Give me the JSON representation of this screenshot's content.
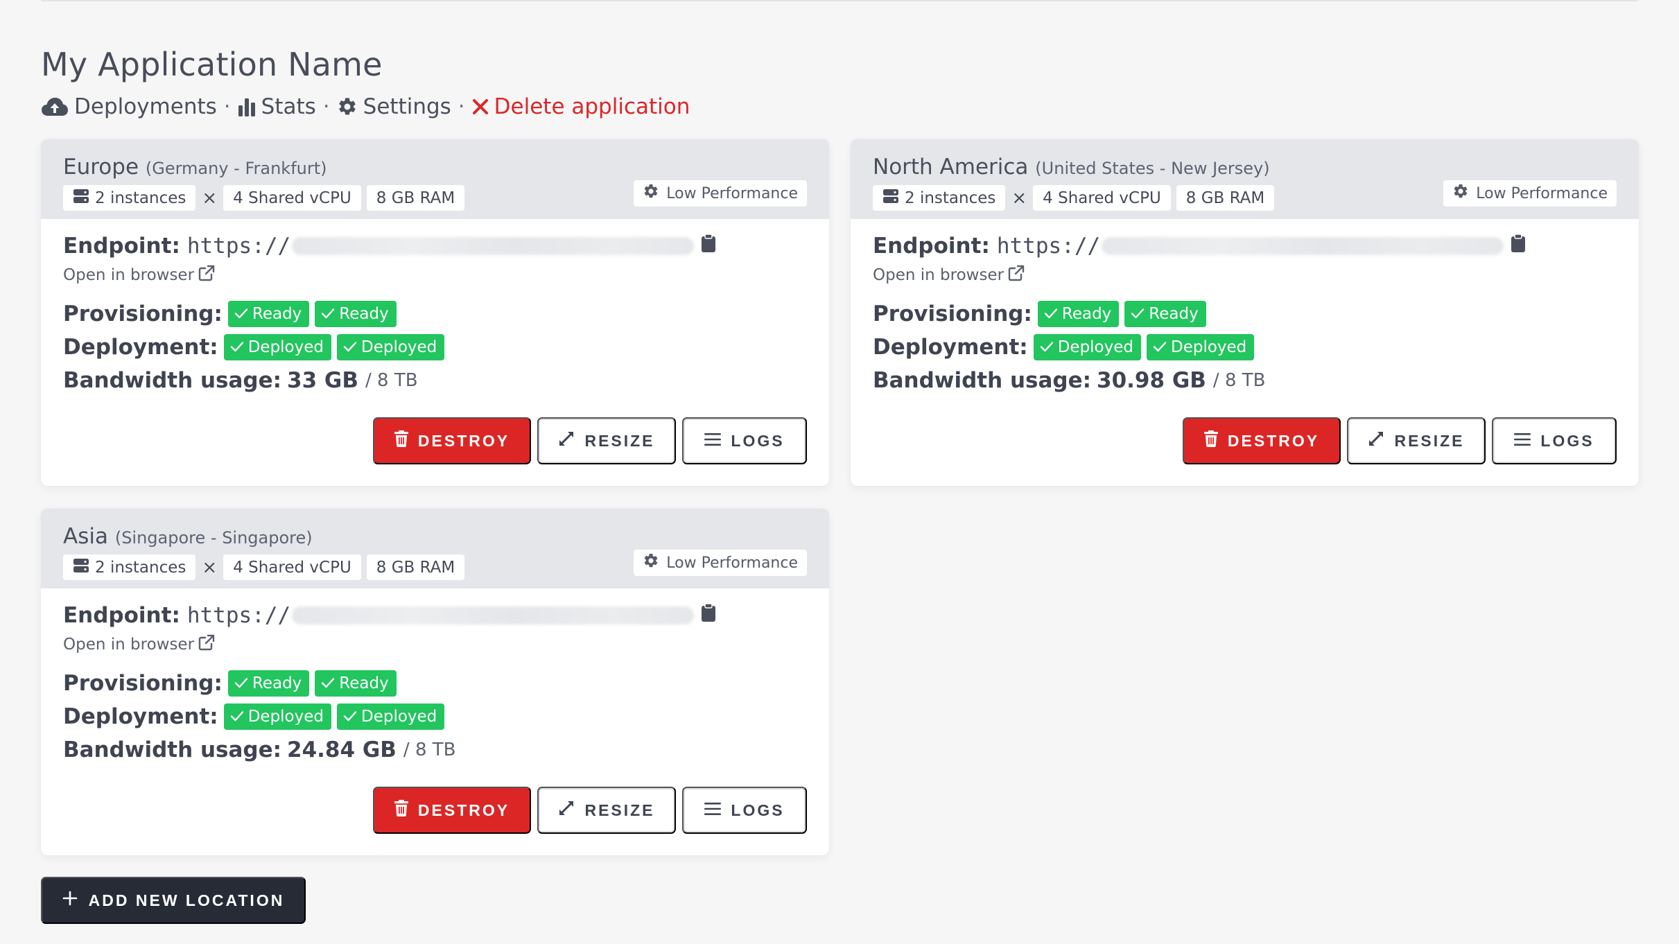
{
  "app": {
    "title": "My Application Name",
    "nav": {
      "deployments": "Deployments",
      "stats": "Stats",
      "settings": "Settings",
      "delete": "Delete application",
      "separator": "·"
    }
  },
  "colors": {
    "danger": "#dc2626",
    "success": "#22c55e",
    "dark_button": "#262b36",
    "card_header": "#e5e6ea"
  },
  "icons": {
    "deployments": "cloud-upload-icon",
    "stats": "bar-chart-icon",
    "settings": "gear-icon",
    "delete": "close-icon",
    "instances": "server-icon",
    "performance": "gear-icon",
    "copy": "clipboard-icon",
    "external": "external-link-icon",
    "status": "check-icon",
    "destroy": "trash-icon",
    "resize": "expand-icon",
    "logs": "menu-lines-icon",
    "add": "plus-icon"
  },
  "locations": [
    {
      "region": "Europe",
      "place": "(Germany - Frankfurt)",
      "instances": "2 instances",
      "times": "×",
      "cpu": "4 Shared vCPU",
      "ram": "8 GB RAM",
      "performance": "Low Performance",
      "endpoint_label": "Endpoint:",
      "endpoint_proto": "https://",
      "open_label": "Open in browser",
      "provisioning_label": "Provisioning:",
      "provisioning": [
        "Ready",
        "Ready"
      ],
      "deployment_label": "Deployment:",
      "deployment": [
        "Deployed",
        "Deployed"
      ],
      "bandwidth_label": "Bandwidth usage:",
      "bandwidth_used": "33 GB",
      "bandwidth_total": "/ 8 TB",
      "destroy_label": "DESTROY",
      "resize_label": "RESIZE",
      "logs_label": "LOGS"
    },
    {
      "region": "North America",
      "place": "(United States - New Jersey)",
      "instances": "2 instances",
      "times": "×",
      "cpu": "4 Shared vCPU",
      "ram": "8 GB RAM",
      "performance": "Low Performance",
      "endpoint_label": "Endpoint:",
      "endpoint_proto": "https://",
      "open_label": "Open in browser",
      "provisioning_label": "Provisioning:",
      "provisioning": [
        "Ready",
        "Ready"
      ],
      "deployment_label": "Deployment:",
      "deployment": [
        "Deployed",
        "Deployed"
      ],
      "bandwidth_label": "Bandwidth usage:",
      "bandwidth_used": "30.98 GB",
      "bandwidth_total": "/ 8 TB",
      "destroy_label": "DESTROY",
      "resize_label": "RESIZE",
      "logs_label": "LOGS"
    },
    {
      "region": "Asia",
      "place": "(Singapore - Singapore)",
      "instances": "2 instances",
      "times": "×",
      "cpu": "4 Shared vCPU",
      "ram": "8 GB RAM",
      "performance": "Low Performance",
      "endpoint_label": "Endpoint:",
      "endpoint_proto": "https://",
      "open_label": "Open in browser",
      "provisioning_label": "Provisioning:",
      "provisioning": [
        "Ready",
        "Ready"
      ],
      "deployment_label": "Deployment:",
      "deployment": [
        "Deployed",
        "Deployed"
      ],
      "bandwidth_label": "Bandwidth usage:",
      "bandwidth_used": "24.84 GB",
      "bandwidth_total": "/ 8 TB",
      "destroy_label": "DESTROY",
      "resize_label": "RESIZE",
      "logs_label": "LOGS"
    }
  ],
  "add_location_label": "ADD NEW LOCATION"
}
